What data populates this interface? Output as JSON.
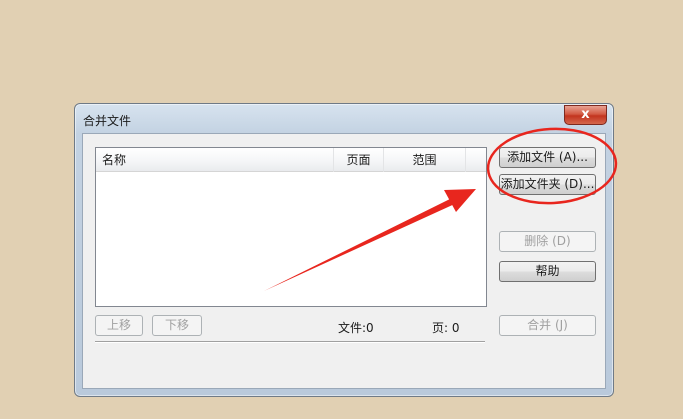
{
  "dialog": {
    "title": "合并文件",
    "close_glyph": "x"
  },
  "list": {
    "columns": {
      "name": "名称",
      "pages": "页面",
      "range": "范围"
    }
  },
  "buttons": {
    "add_file": "添加文件 (A)...",
    "add_folder": "添加文件夹 (D)...",
    "delete": "删除 (D)",
    "help": "帮助",
    "move_up": "上移",
    "move_down": "下移",
    "merge": "合并 (J)"
  },
  "status": {
    "files": "文件:0",
    "pages": "页: 0"
  },
  "annotation": {
    "color": "#e8261e"
  }
}
